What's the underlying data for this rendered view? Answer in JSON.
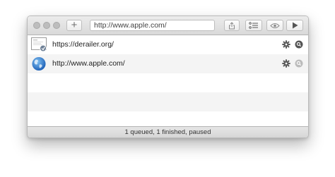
{
  "toolbar": {
    "add_label": "+",
    "url_value": "http://www.apple.com/"
  },
  "rows": [
    {
      "url": "https://derailer.org/",
      "thumbnail": "webpage-thumbnail",
      "gear_icon": "gear-icon",
      "search_icon": "magnifier-icon",
      "search_active": true
    },
    {
      "url": "http://www.apple.com/",
      "thumbnail": "globe-icon",
      "gear_icon": "gear-icon",
      "search_icon": "magnifier-icon",
      "search_active": false
    }
  ],
  "status": {
    "text": "1 queued, 1 finished, paused"
  },
  "colors": {
    "globe": "#2f7fd6",
    "icon_dark": "#555555",
    "icon_light": "#b0b0b0"
  }
}
